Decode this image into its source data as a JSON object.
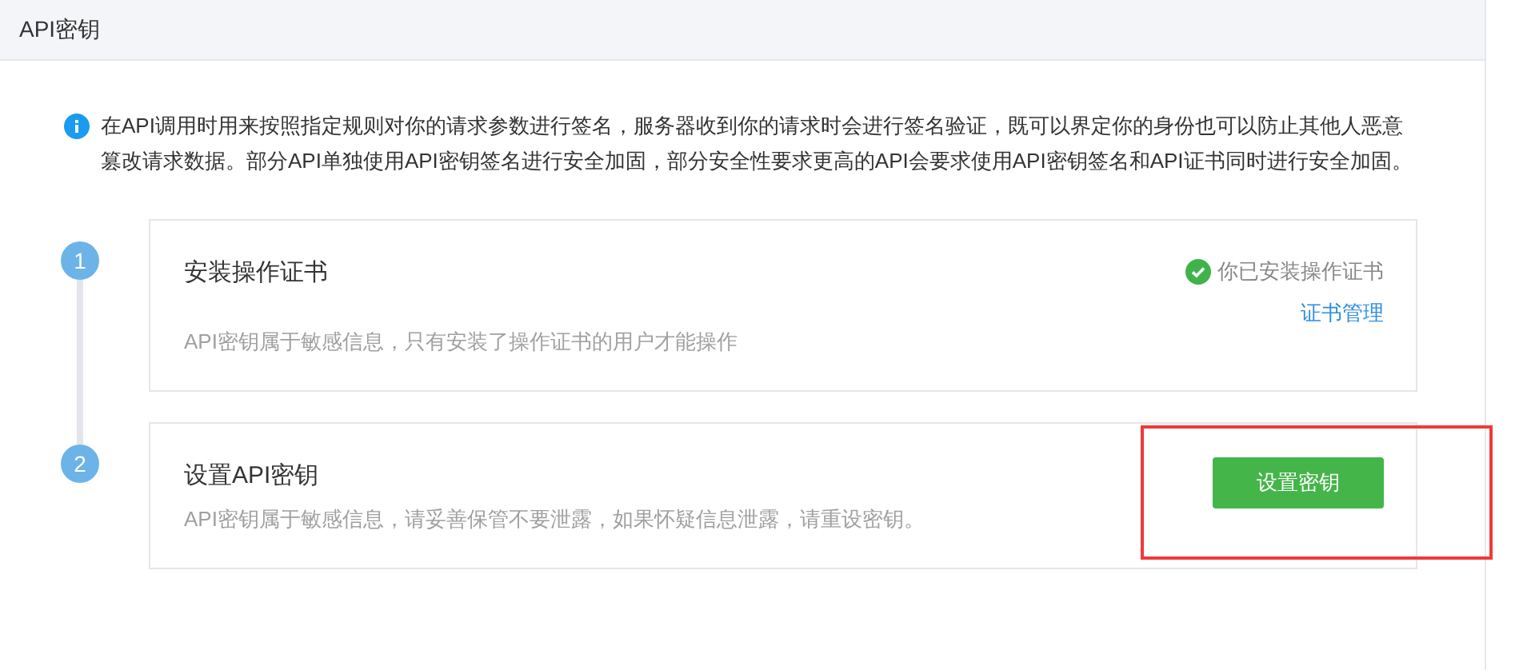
{
  "header": {
    "title": "API密钥"
  },
  "info": {
    "text": "在API调用时用来按照指定规则对你的请求参数进行签名，服务器收到你的请求时会进行签名验证，既可以界定你的身份也可以防止其他人恶意篡改请求数据。部分API单独使用API密钥签名进行安全加固，部分安全性要求更高的API会要求使用API密钥签名和API证书同时进行安全加固。"
  },
  "steps": [
    {
      "number": "1",
      "kind": "status",
      "title": "安装操作证书",
      "description": "API密钥属于敏感信息，只有安装了操作证书的用户才能操作",
      "status": {
        "text": "你已安装操作证书",
        "done": true
      },
      "link": "证书管理"
    },
    {
      "number": "2",
      "kind": "button",
      "title": "设置API密钥",
      "description": "API密钥属于敏感信息，请妥善保管不要泄露，如果怀疑信息泄露，请重设密钥。",
      "button": "设置密钥",
      "highlighted": true
    }
  ]
}
